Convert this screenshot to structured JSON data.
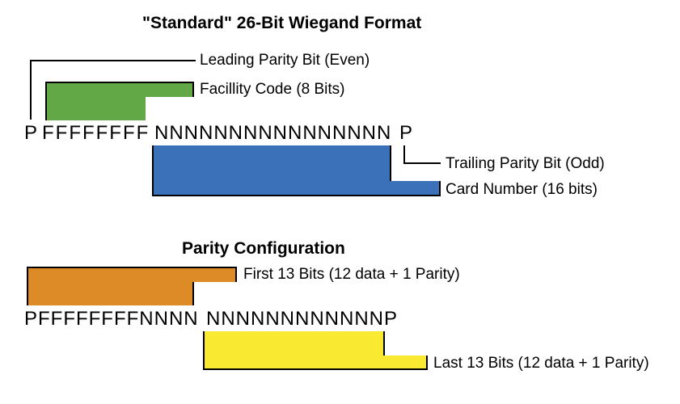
{
  "section1": {
    "title": "\"Standard\" 26-Bit Wiegand Format",
    "labels": {
      "leading_parity": "Leading Parity Bit (Even)",
      "facility_code": "Facillity Code (8 Bits)",
      "trailing_parity": "Trailing Parity Bit (Odd)",
      "card_number": "Card Number (16 bits)"
    },
    "bits": {
      "p1": "P",
      "facility": "FFFFFFFF",
      "card": "NNNNNNNNNNNNNNNN",
      "p2": "P"
    },
    "colors": {
      "facility_box": "#62a846",
      "card_box": "#3b71b8"
    }
  },
  "section2": {
    "title": "Parity Configuration",
    "labels": {
      "first13": "First 13 Bits (12 data + 1 Parity)",
      "last13": "Last 13 Bits (12 data + 1 Parity)"
    },
    "bits": {
      "first_half": "PFFFFFFFFNNNN",
      "second_half": "NNNNNNNNNNNNP"
    },
    "colors": {
      "first_box": "#dd8b27",
      "last_box": "#fae931"
    }
  }
}
